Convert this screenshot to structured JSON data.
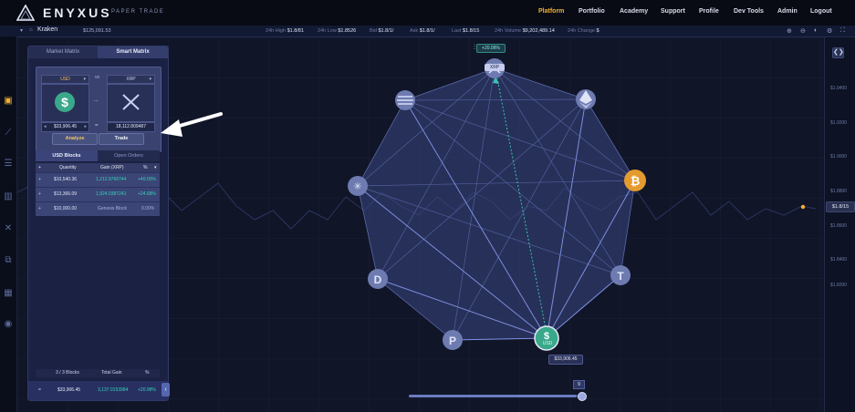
{
  "brand": {
    "name": "ENYXUS",
    "subtitle": "PAPER TRADE"
  },
  "nav": {
    "items": [
      "Platform",
      "Portfolio",
      "Academy",
      "Support",
      "Profile",
      "Dev Tools",
      "Admin",
      "Logout"
    ],
    "active": "Platform"
  },
  "ticker": {
    "exchange": "Kraken",
    "balance": "$125,091.53",
    "stats": [
      {
        "label": "24h High",
        "value": "$1.8/81"
      },
      {
        "label": "24h Low",
        "value": "$1.8526"
      },
      {
        "label": "Bid",
        "value": "$1.8/1/"
      },
      {
        "label": "Ask",
        "value": "$1.8/1/"
      },
      {
        "label": "Last",
        "value": "$1.8/15"
      },
      {
        "label": "24h Volume",
        "value": "$9,202,489.14"
      },
      {
        "label": "24h Change",
        "value": "$"
      }
    ]
  },
  "price_axis": {
    "ticks": [
      "$1.9400",
      "$1.9200",
      "$1.9000",
      "$1.8800",
      "$1.8600",
      "$1.8400",
      "$1.8200"
    ],
    "current": "$1.8/15"
  },
  "panel": {
    "tabs": [
      "Market Matrix",
      "Smart Matrix"
    ],
    "active_tab": "Smart Matrix",
    "from_coin": "USD",
    "to_symbol": "vs",
    "to_coin": "XRP",
    "from_amount": "$33,906.45",
    "equals": "=",
    "to_amount": "18,112.809487",
    "analyze_label": "Analyze",
    "trade_label": "Trade",
    "block_tabs": [
      "USD Blocks",
      "Open Orders"
    ],
    "table_headers": [
      "Quantity",
      "Gain (XRP)",
      "%"
    ],
    "rows": [
      {
        "quantity": "$10,540.36",
        "gain": "1,212.9766744",
        "pct": "+40.00%"
      },
      {
        "quantity": "$13,366.09",
        "gain": "1,924.0387241",
        "pct": "+24.68%"
      },
      {
        "quantity": "$10,000.00",
        "gain": "Genesis Block",
        "pct": "0.00%"
      }
    ],
    "footer": {
      "blocks": "3 / 3 Blocks",
      "total_gain": "Total Gain",
      "pct": "%"
    },
    "summary": {
      "eq": "=",
      "amount": "$33,906.45",
      "gain": "3,137.0153984",
      "pct": "+20.98%"
    }
  },
  "network": {
    "top_label": "+20.98%",
    "top_coin": "XRP",
    "bottom_coin": "USD",
    "bottom_amount": "$33,906.45"
  },
  "slider": {
    "value": "9",
    "level": 0.97
  },
  "colors": {
    "accent": "#f2b033",
    "teal": "#3bc3b0",
    "usd_green": "#3aa88a",
    "btc": "#e39b2f"
  }
}
